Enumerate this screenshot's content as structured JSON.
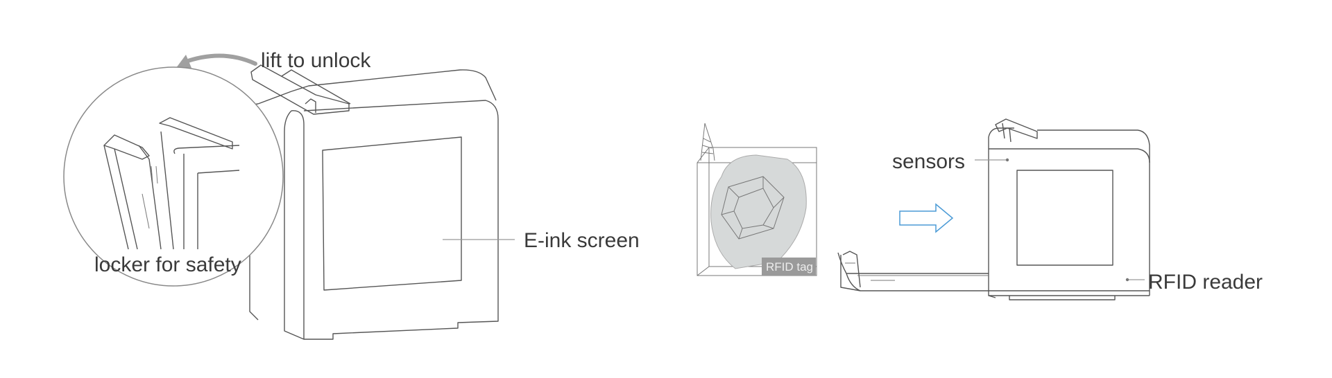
{
  "labels": {
    "lift_to_unlock": "lift to unlock",
    "locker_for_safety": "locker for safety",
    "e_ink_screen": "E-ink screen",
    "rfid_tag": "RFID tag",
    "sensors": "sensors",
    "rfid_reader": "RFID reader"
  },
  "colors": {
    "line": "#555555",
    "arrow_gray": "#a0a0a0",
    "arrow_blue": "#4a9ad6",
    "tag_fill": "#9a9a9a",
    "roll_fill": "#d6d9d9"
  },
  "icons": {
    "unlock_arrow": "curved-arrow-left-icon",
    "insert_arrow": "right-arrow-icon"
  }
}
